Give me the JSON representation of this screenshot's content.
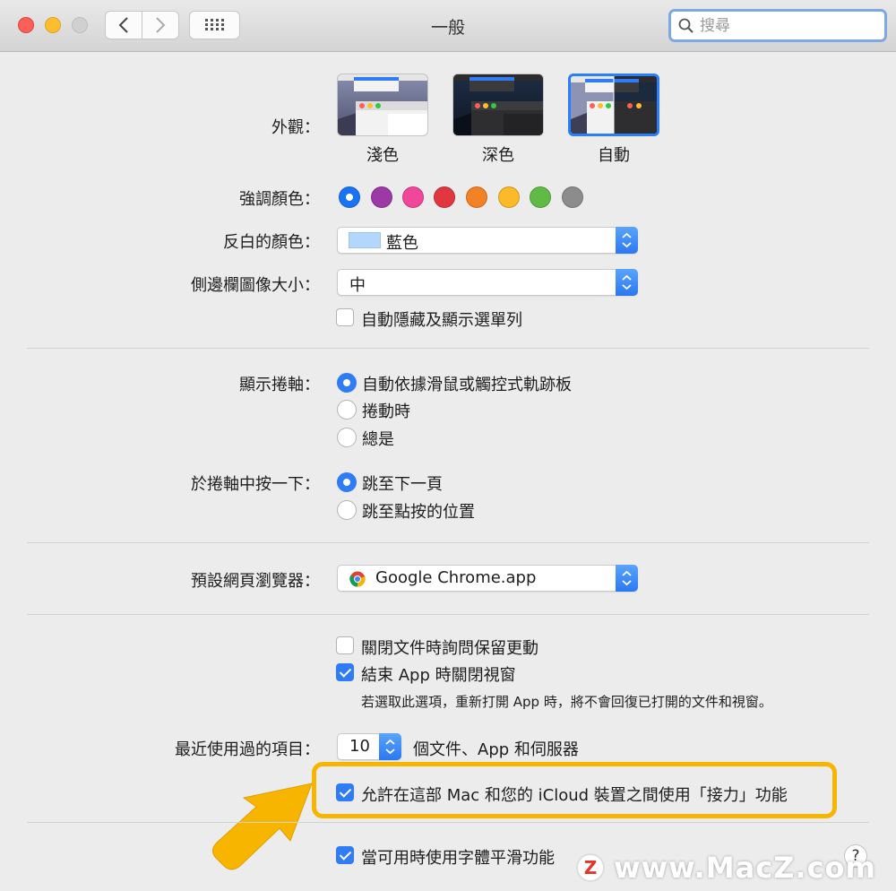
{
  "window": {
    "title": "一般"
  },
  "search": {
    "placeholder": "搜尋"
  },
  "appearance": {
    "label": "外觀：",
    "options": [
      {
        "label": "淺色",
        "selected": false
      },
      {
        "label": "深色",
        "selected": false
      },
      {
        "label": "自動",
        "selected": true
      }
    ]
  },
  "accent": {
    "label": "強調顏色：",
    "colors": [
      "#1a73f5",
      "#9b3aa5",
      "#f0479b",
      "#e0383e",
      "#f38226",
      "#fbba2a",
      "#62ba46",
      "#8c8c8c"
    ],
    "selected_index": 0
  },
  "highlight": {
    "label": "反白的顏色：",
    "value": "藍色",
    "swatch": "#b3d6fb"
  },
  "sidebar": {
    "label": "側邊欄圖像大小：",
    "value": "中"
  },
  "menubar": {
    "label": "自動隱藏及顯示選單列",
    "checked": false
  },
  "scrollbars": {
    "label": "顯示捲軸：",
    "options": [
      {
        "label": "自動依據滑鼠或觸控式軌跡板",
        "selected": true
      },
      {
        "label": "捲動時",
        "selected": false
      },
      {
        "label": "總是",
        "selected": false
      }
    ]
  },
  "scroll_click": {
    "label": "於捲軸中按一下：",
    "options": [
      {
        "label": "跳至下一頁",
        "selected": true
      },
      {
        "label": "跳至點按的位置",
        "selected": false
      }
    ]
  },
  "browser": {
    "label": "預設網頁瀏覽器：",
    "value": "Google Chrome.app"
  },
  "close_docs": {
    "label": "關閉文件時詢問保留更動",
    "checked": false
  },
  "quit_apps": {
    "label": "結束 App 時關閉視窗",
    "checked": true
  },
  "quit_note": "若選取此選項，重新打開 App 時，將不會回復已打開的文件和視窗。",
  "recent": {
    "label": "最近使用過的項目：",
    "value": "10",
    "suffix": "個文件、App 和伺服器"
  },
  "handoff": {
    "label": "允許在這部 Mac 和您的 iCloud 裝置之間使用「接力」功能",
    "checked": true
  },
  "font_smoothing": {
    "label": "當可用時使用字體平滑功能",
    "checked": true
  },
  "help": "?",
  "watermark": {
    "logo": "Z",
    "text": "www.MacZ.com"
  },
  "colors": {
    "accent_blue": "#2f7cf6",
    "annotation_yellow": "#f7b500"
  }
}
